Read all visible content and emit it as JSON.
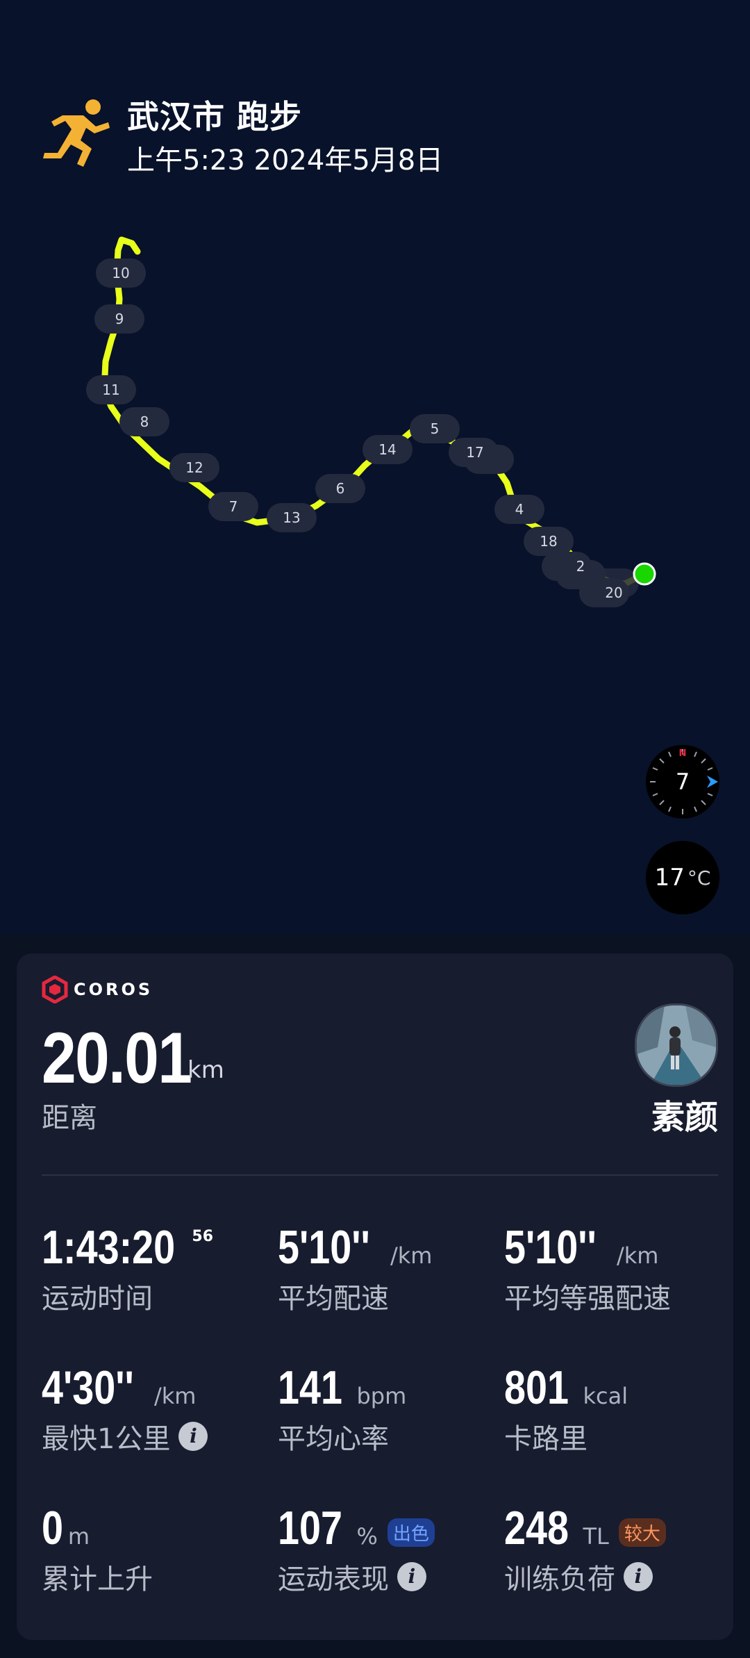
{
  "header": {
    "title": "武汉市 跑步",
    "subtitle": "上午5:23 2024年5月8日",
    "icon": "running-icon"
  },
  "map": {
    "km_markers": [
      "10",
      "9",
      "11",
      "8",
      "12",
      "7",
      "13",
      "6",
      "14",
      "5",
      "17",
      "4",
      "18",
      "2",
      "20"
    ],
    "route_color": "#e8ff1a",
    "end_point_color": "#19d600",
    "compass": {
      "value": "7",
      "direction_letter": "N"
    },
    "temperature": {
      "value": "17",
      "unit": "°C"
    }
  },
  "card": {
    "brand": "COROS",
    "distance": {
      "value": "20.01",
      "unit": "km",
      "label": "距离"
    },
    "user": {
      "name": "素颜"
    },
    "stats": [
      {
        "value": "1:43:20",
        "sup": "56",
        "unit": "",
        "label": "运动时间"
      },
      {
        "value": "5'10''",
        "unit": "/km",
        "label": "平均配速"
      },
      {
        "value": "5'10''",
        "unit": "/km",
        "label": "平均等强配速"
      },
      {
        "value": "4'30''",
        "unit": "/km",
        "label": "最快1公里",
        "info": true
      },
      {
        "value": "141",
        "unit": "bpm",
        "label": "平均心率"
      },
      {
        "value": "801",
        "unit": "kcal",
        "label": "卡路里"
      },
      {
        "value": "0",
        "unit": "m",
        "label": "累计上升"
      },
      {
        "value": "107",
        "unit": "%",
        "tag": "出色",
        "label": "运动表现",
        "info": true
      },
      {
        "value": "248",
        "unit": "TL",
        "tag": "较大",
        "label": "训练负荷",
        "info": true
      }
    ]
  },
  "colors": {
    "background": "#08122a",
    "card": "#171c2f",
    "brand_red": "#e5283f",
    "tag_blue": "#73a4ff",
    "tag_orange": "#ff9660"
  }
}
